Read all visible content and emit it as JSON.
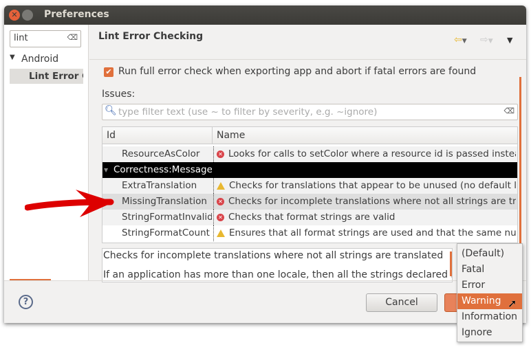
{
  "window": {
    "title": "Preferences"
  },
  "sidebar": {
    "search_value": "lint",
    "tree": [
      {
        "label": "Android",
        "expanded": true
      },
      {
        "label": "Lint Error Checking",
        "selected": true
      }
    ]
  },
  "main": {
    "title": "Lint Error Checking",
    "checkbox_label": "Run full error check when exporting app and abort if fatal errors are found",
    "checkbox_checked": true,
    "issues_label": "Issues:",
    "filter_placeholder": "type filter text (use ~ to filter by severity, e.g. ~ignore)",
    "columns": [
      "Id",
      "Name"
    ],
    "rows": [
      {
        "id": "ResourceAsColor",
        "severity": "error",
        "name": "Looks for calls to setColor where a resource id is passed instead of a resolved color"
      },
      {
        "category": "Correctness:Messages"
      },
      {
        "id": "ExtraTranslation",
        "severity": "warning",
        "name": "Checks for translations that appear to be unused (no default language string)"
      },
      {
        "id": "MissingTranslation",
        "severity": "error",
        "name": "Checks for incomplete translations where not all strings are translated",
        "selected": true
      },
      {
        "id": "StringFormatInvalid",
        "severity": "error",
        "name": "Checks that format strings are valid"
      },
      {
        "id": "StringFormatCount",
        "severity": "warning",
        "name": "Ensures that all format strings are used and that the same number is defined across translations"
      }
    ],
    "description_line1": "Checks for incomplete translations where not all strings are translated",
    "description_line2": "If an application has more than one locale, then all the strings declared in"
  },
  "severity_menu": {
    "options": [
      "(Default)",
      "Fatal",
      "Error",
      "Warning",
      "Information",
      "Ignore"
    ],
    "highlighted": "Warning"
  },
  "footer": {
    "cancel_label": "Cancel"
  },
  "colors": {
    "accent": "#e0703c",
    "selection": "#000000",
    "arrow": "#dd0000"
  }
}
